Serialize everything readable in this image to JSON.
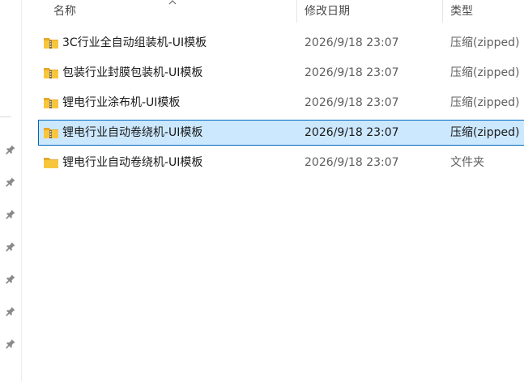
{
  "columns": {
    "name": "名称",
    "modified": "修改日期",
    "type": "类型"
  },
  "files": [
    {
      "name": "3C行业全自动组装机-UI模板",
      "modified": "2026/9/18 23:07",
      "type": "压缩(zipped)",
      "icon": "zip-folder-icon",
      "selected": false
    },
    {
      "name": "包装行业封膜包装机-UI模板",
      "modified": "2026/9/18 23:07",
      "type": "压缩(zipped)",
      "icon": "zip-folder-icon",
      "selected": false
    },
    {
      "name": "锂电行业涂布机-UI模板",
      "modified": "2026/9/18 23:07",
      "type": "压缩(zipped)",
      "icon": "zip-folder-icon",
      "selected": false
    },
    {
      "name": "锂电行业自动卷绕机-UI模板",
      "modified": "2026/9/18 23:07",
      "type": "压缩(zipped)",
      "icon": "zip-folder-icon",
      "selected": true
    },
    {
      "name": "锂电行业自动卷绕机-UI模板",
      "modified": "2026/9/18 23:07",
      "type": "文件夹",
      "icon": "folder-icon",
      "selected": false
    }
  ],
  "nav_pane": {
    "pinned_icons": [
      "pin-icon",
      "pin-icon",
      "pin-icon",
      "pin-icon",
      "pin-icon",
      "pin-icon",
      "pin-icon"
    ]
  },
  "colors": {
    "selection_bg": "#cce8ff",
    "selection_border": "#0067c0",
    "folder_yellow": "#f8c63d"
  }
}
